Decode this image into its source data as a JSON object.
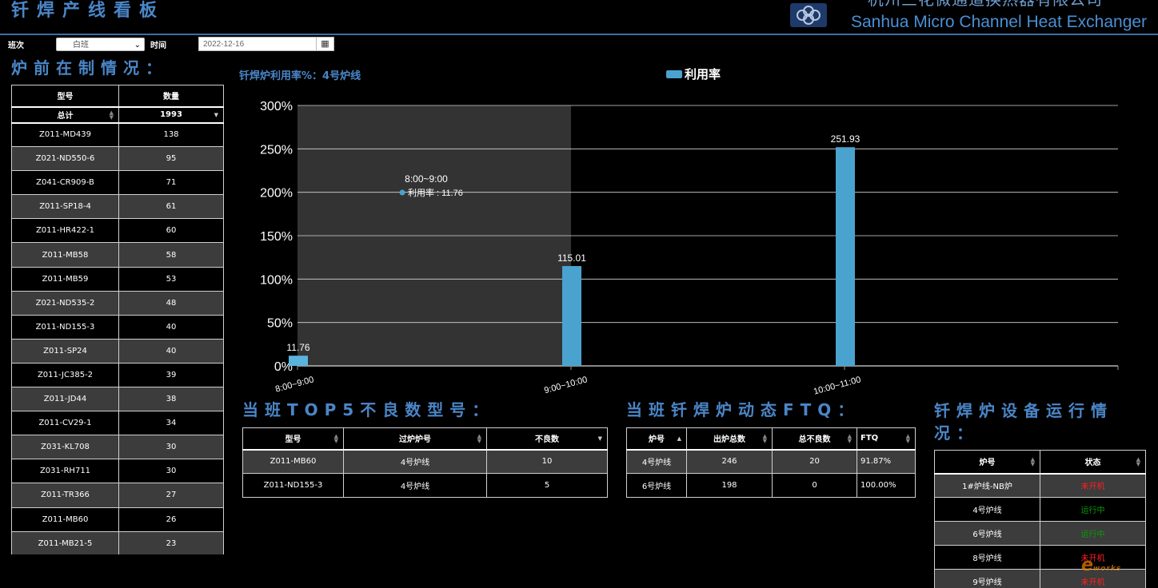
{
  "header": {
    "title": "钎焊产线看板",
    "company_cn": "杭州三花微通道换热器有限公司",
    "company_en": "Sanhua Micro Channel Heat Exchanger"
  },
  "filters": {
    "shift_label": "班次",
    "shift_value": "白班",
    "time_label": "时间",
    "date_value": "2022-12-16"
  },
  "wip": {
    "title": "炉前在制情况：",
    "columns": [
      "型号",
      "数量"
    ],
    "total_label": "总计",
    "total_value": "1993",
    "rows": [
      {
        "model": "Z011-MD439",
        "qty": "138"
      },
      {
        "model": "Z021-ND550-6",
        "qty": "95"
      },
      {
        "model": "Z041-CR909-B",
        "qty": "71"
      },
      {
        "model": "Z011-SP18-4",
        "qty": "61"
      },
      {
        "model": "Z011-HR422-1",
        "qty": "60"
      },
      {
        "model": "Z011-MB58",
        "qty": "58"
      },
      {
        "model": "Z011-MB59",
        "qty": "53"
      },
      {
        "model": "Z021-ND535-2",
        "qty": "48"
      },
      {
        "model": "Z011-ND155-3",
        "qty": "40"
      },
      {
        "model": "Z011-SP24",
        "qty": "40"
      },
      {
        "model": "Z011-JC385-2",
        "qty": "39"
      },
      {
        "model": "Z011-JD44",
        "qty": "38"
      },
      {
        "model": "Z011-CV29-1",
        "qty": "34"
      },
      {
        "model": "Z031-KL708",
        "qty": "30"
      },
      {
        "model": "Z031-RH711",
        "qty": "30"
      },
      {
        "model": "Z011-TR366",
        "qty": "27"
      },
      {
        "model": "Z011-MB60",
        "qty": "26"
      },
      {
        "model": "Z011-MB21-5",
        "qty": "23"
      }
    ]
  },
  "chart_data": {
    "type": "bar",
    "title": "钎焊炉利用率%：4号炉线",
    "categories": [
      "8:00~9:00",
      "9:00~10:00",
      "10:00~11:00"
    ],
    "series": [
      {
        "name": "利用率",
        "values": [
          11.76,
          115.01,
          251.93
        ],
        "color": "#4aa3cf"
      }
    ],
    "ylim": [
      0,
      300
    ],
    "yticks": [
      0,
      50,
      100,
      150,
      200,
      250,
      300
    ],
    "ytick_suffix": "%",
    "grid": true,
    "legend_position": "top-center",
    "tooltip": {
      "title": "8:00~9:00",
      "label": "利用率 : 11.76",
      "category_index": 0
    },
    "highlight_category": 0
  },
  "top5": {
    "title": "当班TOP5不良数型号：",
    "columns": [
      "型号",
      "过炉炉号",
      "不良数"
    ],
    "rows": [
      [
        "Z011-MB60",
        "4号炉线",
        "10"
      ],
      [
        "Z011-ND155-3",
        "4号炉线",
        "5"
      ]
    ]
  },
  "ftq": {
    "title": "当班钎焊炉动态FTQ：",
    "columns": [
      "炉号",
      "出炉总数",
      "总不良数",
      "FTQ"
    ],
    "rows": [
      [
        "4号炉线",
        "246",
        "20",
        "91.87%"
      ],
      [
        "6号炉线",
        "198",
        "0",
        "100.00%"
      ]
    ]
  },
  "equipment": {
    "title_line1": "钎焊炉设备运行情",
    "title_line2": "况：",
    "columns": [
      "炉号",
      "状态"
    ],
    "rows": [
      {
        "name": "1#炉线-NB炉",
        "status": "未开机",
        "color": "#ff2020"
      },
      {
        "name": "4号炉线",
        "status": "运行中",
        "color": "#0a9a0a"
      },
      {
        "name": "6号炉线",
        "status": "运行中",
        "color": "#0a9a0a"
      },
      {
        "name": "8号炉线",
        "status": "未开机",
        "color": "#ff2020"
      },
      {
        "name": "9号炉线",
        "status": "未开机",
        "color": "#ff2020"
      }
    ]
  }
}
